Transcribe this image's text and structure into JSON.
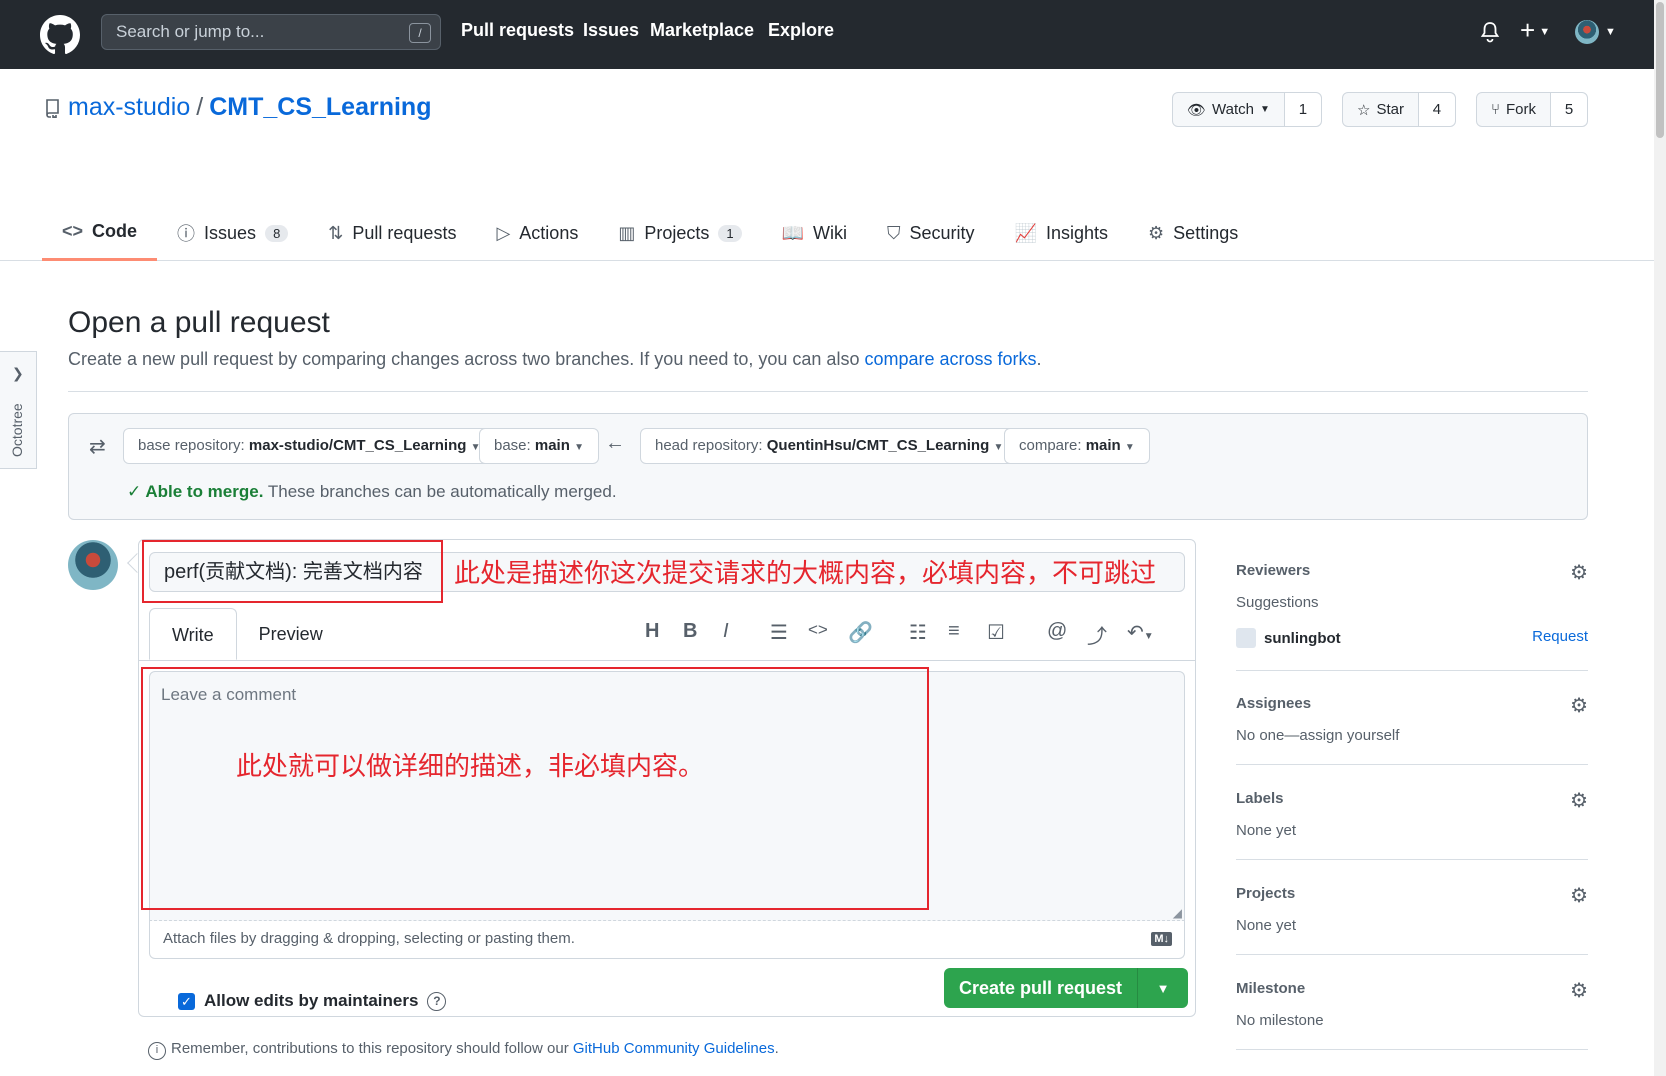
{
  "header": {
    "search_placeholder": "Search or jump to...",
    "search_shortcut": "/",
    "nav": [
      "Pull requests",
      "Issues",
      "Marketplace",
      "Explore"
    ]
  },
  "repo": {
    "owner": "max-studio",
    "separator": "/",
    "name": "CMT_CS_Learning",
    "watch_label": "Watch",
    "watch_count": "1",
    "star_label": "Star",
    "star_count": "4",
    "fork_label": "Fork",
    "fork_count": "5"
  },
  "tabs": [
    {
      "label": "Code",
      "icon": "code-icon",
      "count": ""
    },
    {
      "label": "Issues",
      "icon": "issue-icon",
      "count": "8"
    },
    {
      "label": "Pull requests",
      "icon": "pr-icon",
      "count": ""
    },
    {
      "label": "Actions",
      "icon": "play-icon",
      "count": ""
    },
    {
      "label": "Projects",
      "icon": "project-icon",
      "count": "1"
    },
    {
      "label": "Wiki",
      "icon": "book-icon",
      "count": ""
    },
    {
      "label": "Security",
      "icon": "shield-icon",
      "count": ""
    },
    {
      "label": "Insights",
      "icon": "graph-icon",
      "count": ""
    },
    {
      "label": "Settings",
      "icon": "gear-icon",
      "count": ""
    }
  ],
  "octotree": {
    "label": "Octotree"
  },
  "page": {
    "title": "Open a pull request",
    "subtitle": "Create a new pull request by comparing changes across two branches. If you need to, you can also ",
    "subtitle_link": "compare across forks",
    "subtitle_end": "."
  },
  "range": {
    "base_repo_prefix": "base repository: ",
    "base_repo": "max-studio/CMT_CS_Learning",
    "base_prefix": "base: ",
    "base": "main",
    "head_repo_prefix": "head repository: ",
    "head_repo": "QuentinHsu/CMT_CS_Learning",
    "compare_prefix": "compare: ",
    "compare": "main",
    "merge_ok": "Able to merge.",
    "merge_text": " These branches can be automatically merged."
  },
  "composer": {
    "title_value": "perf(贡献文档): 完善文档内容",
    "title_annotation": "此处是描述你这次提交请求的大概内容，必填内容，不可跳过",
    "tab_write": "Write",
    "tab_preview": "Preview",
    "comment_placeholder": "Leave a comment",
    "comment_annotation": "此处就可以做详细的描述，非必填内容。",
    "attach_text": "Attach files by dragging & dropping, selecting or pasting them.",
    "markdown_badge": "M↓",
    "allow_edits": "Allow edits by maintainers",
    "create_button": "Create pull request"
  },
  "footer": {
    "remember": "Remember, contributions to this repository should follow our ",
    "link": "GitHub Community Guidelines",
    "end": "."
  },
  "sidebar": {
    "reviewers": {
      "heading": "Reviewers",
      "suggestions": "Suggestions",
      "user": "sunlingbot",
      "request": "Request"
    },
    "assignees": {
      "heading": "Assignees",
      "value": "No one—assign yourself"
    },
    "labels": {
      "heading": "Labels",
      "value": "None yet"
    },
    "projects": {
      "heading": "Projects",
      "value": "None yet"
    },
    "milestone": {
      "heading": "Milestone",
      "value": "No milestone"
    }
  },
  "colors": {
    "header_bg": "#24292f",
    "link": "#0969da",
    "green": "#2da44e",
    "annotation_red": "#e5262e",
    "tab_underline": "#fd8c73"
  }
}
